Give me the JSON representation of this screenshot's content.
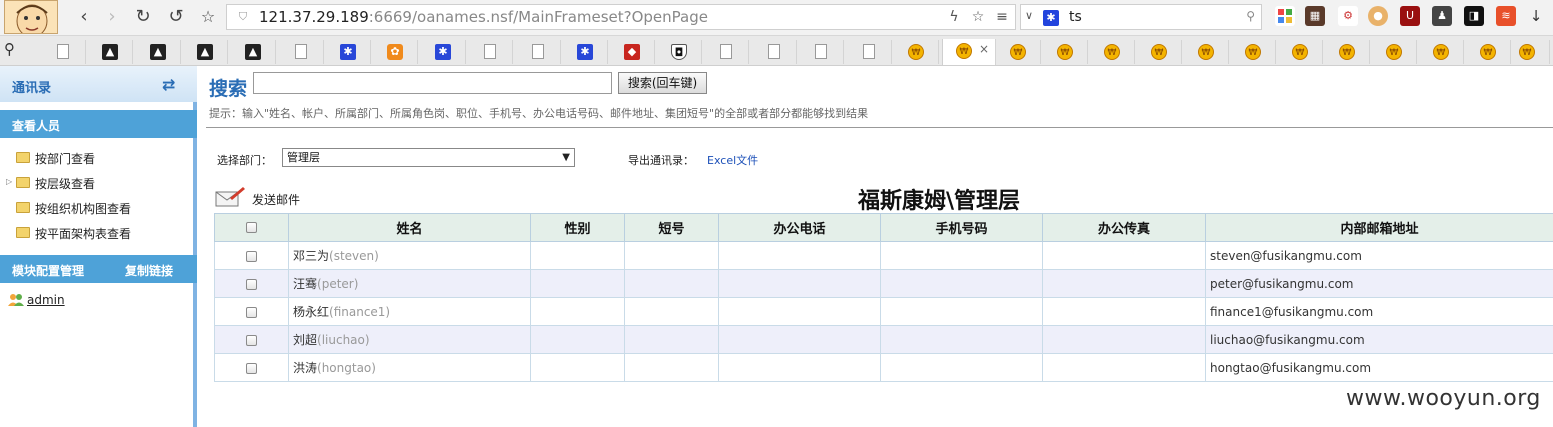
{
  "browser": {
    "url_host": "121.37.29.189",
    "url_rest": ":6669/oanames.nsf/MainFrameset?OpenPage",
    "search_text": "ts",
    "active_tab_close": "×"
  },
  "sidebar": {
    "title": "通讯录",
    "section_view": "查看人员",
    "items": [
      {
        "label": "按部门查看"
      },
      {
        "label": "按层级查看"
      },
      {
        "label": "按组织机构图查看"
      },
      {
        "label": "按平面架构表查看"
      }
    ],
    "section_module": "模块配置管理",
    "copy_link": "复制链接",
    "user": "admin"
  },
  "main": {
    "search_title": "搜索",
    "search_value": "",
    "search_button": "搜索(回车键)",
    "hint": "提示：输入\"姓名、帐户、所属部门、所属角色岗、职位、手机号、办公电话号码、邮件地址、集团短号\"的全部或者部分都能够找到结果",
    "dept_label": "选择部门：",
    "dept_selected": "管理层",
    "export_label": "导出通讯录：",
    "export_link": "Excel文件",
    "send_mail": "发送邮件",
    "org_title": "福斯康姆\\管理层"
  },
  "table": {
    "headers": [
      "姓名",
      "性别",
      "短号",
      "办公电话",
      "手机号码",
      "办公传真",
      "内部邮箱地址"
    ],
    "rows": [
      {
        "name": "邓三为",
        "en": "(steven)",
        "gender": "",
        "short": "",
        "phone": "",
        "mobile": "",
        "fax": "",
        "email": "steven@fusikangmu.com"
      },
      {
        "name": "汪骞",
        "en": "(peter)",
        "gender": "",
        "short": "",
        "phone": "",
        "mobile": "",
        "fax": "",
        "email": "peter@fusikangmu.com"
      },
      {
        "name": "杨永红",
        "en": "(finance1)",
        "gender": "",
        "short": "",
        "phone": "",
        "mobile": "",
        "fax": "",
        "email": "finance1@fusikangmu.com"
      },
      {
        "name": "刘超",
        "en": "(liuchao)",
        "gender": "",
        "short": "",
        "phone": "",
        "mobile": "",
        "fax": "",
        "email": "liuchao@fusikangmu.com"
      },
      {
        "name": "洪涛",
        "en": "(hongtao)",
        "gender": "",
        "short": "",
        "phone": "",
        "mobile": "",
        "fax": "",
        "email": "hongtao@fusikangmu.com"
      }
    ]
  },
  "watermark": "www.wooyun.org"
}
